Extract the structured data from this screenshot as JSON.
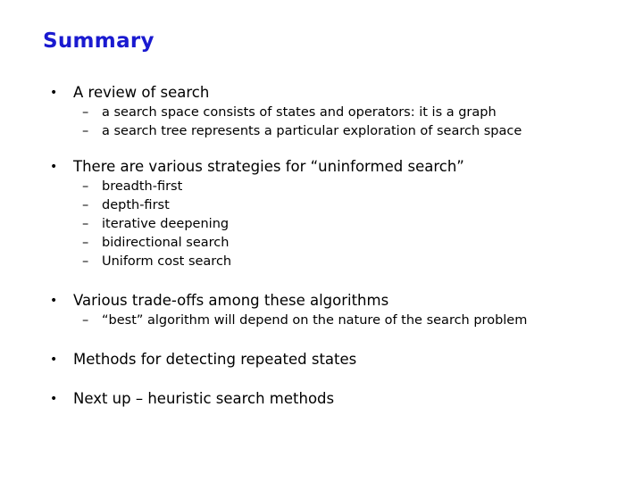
{
  "title": "Summary",
  "bullet_glyph": "•",
  "dash_glyph": "–",
  "items": [
    {
      "text": "A review of search",
      "subitems": [
        "a search space consists of states and operators: it is a graph",
        "a search tree represents a particular exploration of search space"
      ]
    },
    {
      "text": "There are various strategies for “uninformed search”",
      "subitems": [
        "breadth-first",
        "depth-first",
        "iterative deepening",
        "bidirectional search",
        "Uniform cost search"
      ]
    },
    {
      "text": "Various trade-offs among these algorithms",
      "subitems": [
        "“best” algorithm will depend on the nature of the search problem"
      ]
    },
    {
      "text": "Methods for detecting repeated states",
      "subitems": []
    },
    {
      "text": "Next up – heuristic search methods",
      "subitems": []
    }
  ]
}
